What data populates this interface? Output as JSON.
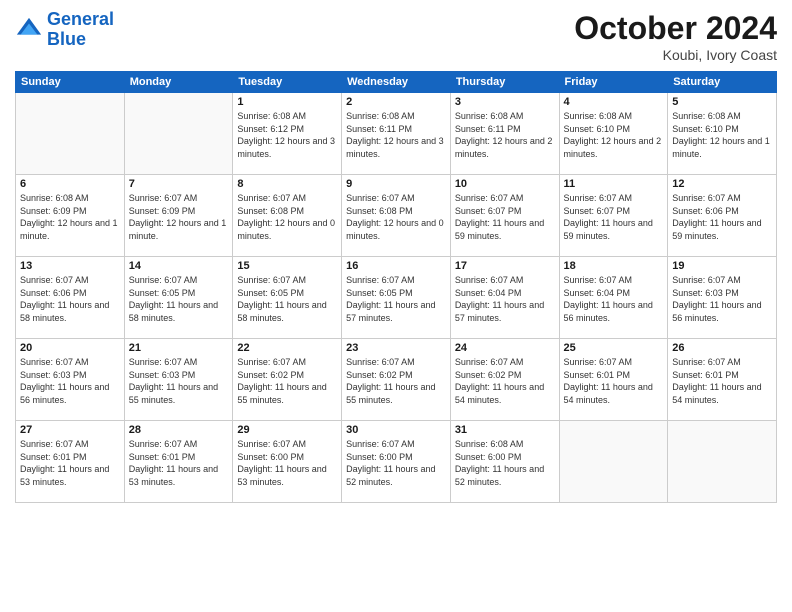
{
  "header": {
    "logo_general": "General",
    "logo_blue": "Blue",
    "month_title": "October 2024",
    "subtitle": "Koubi, Ivory Coast"
  },
  "days_of_week": [
    "Sunday",
    "Monday",
    "Tuesday",
    "Wednesday",
    "Thursday",
    "Friday",
    "Saturday"
  ],
  "weeks": [
    [
      {
        "day": "",
        "empty": true
      },
      {
        "day": "",
        "empty": true
      },
      {
        "day": "1",
        "sunrise": "Sunrise: 6:08 AM",
        "sunset": "Sunset: 6:12 PM",
        "daylight": "Daylight: 12 hours and 3 minutes."
      },
      {
        "day": "2",
        "sunrise": "Sunrise: 6:08 AM",
        "sunset": "Sunset: 6:11 PM",
        "daylight": "Daylight: 12 hours and 3 minutes."
      },
      {
        "day": "3",
        "sunrise": "Sunrise: 6:08 AM",
        "sunset": "Sunset: 6:11 PM",
        "daylight": "Daylight: 12 hours and 2 minutes."
      },
      {
        "day": "4",
        "sunrise": "Sunrise: 6:08 AM",
        "sunset": "Sunset: 6:10 PM",
        "daylight": "Daylight: 12 hours and 2 minutes."
      },
      {
        "day": "5",
        "sunrise": "Sunrise: 6:08 AM",
        "sunset": "Sunset: 6:10 PM",
        "daylight": "Daylight: 12 hours and 1 minute."
      }
    ],
    [
      {
        "day": "6",
        "sunrise": "Sunrise: 6:08 AM",
        "sunset": "Sunset: 6:09 PM",
        "daylight": "Daylight: 12 hours and 1 minute."
      },
      {
        "day": "7",
        "sunrise": "Sunrise: 6:07 AM",
        "sunset": "Sunset: 6:09 PM",
        "daylight": "Daylight: 12 hours and 1 minute."
      },
      {
        "day": "8",
        "sunrise": "Sunrise: 6:07 AM",
        "sunset": "Sunset: 6:08 PM",
        "daylight": "Daylight: 12 hours and 0 minutes."
      },
      {
        "day": "9",
        "sunrise": "Sunrise: 6:07 AM",
        "sunset": "Sunset: 6:08 PM",
        "daylight": "Daylight: 12 hours and 0 minutes."
      },
      {
        "day": "10",
        "sunrise": "Sunrise: 6:07 AM",
        "sunset": "Sunset: 6:07 PM",
        "daylight": "Daylight: 11 hours and 59 minutes."
      },
      {
        "day": "11",
        "sunrise": "Sunrise: 6:07 AM",
        "sunset": "Sunset: 6:07 PM",
        "daylight": "Daylight: 11 hours and 59 minutes."
      },
      {
        "day": "12",
        "sunrise": "Sunrise: 6:07 AM",
        "sunset": "Sunset: 6:06 PM",
        "daylight": "Daylight: 11 hours and 59 minutes."
      }
    ],
    [
      {
        "day": "13",
        "sunrise": "Sunrise: 6:07 AM",
        "sunset": "Sunset: 6:06 PM",
        "daylight": "Daylight: 11 hours and 58 minutes."
      },
      {
        "day": "14",
        "sunrise": "Sunrise: 6:07 AM",
        "sunset": "Sunset: 6:05 PM",
        "daylight": "Daylight: 11 hours and 58 minutes."
      },
      {
        "day": "15",
        "sunrise": "Sunrise: 6:07 AM",
        "sunset": "Sunset: 6:05 PM",
        "daylight": "Daylight: 11 hours and 58 minutes."
      },
      {
        "day": "16",
        "sunrise": "Sunrise: 6:07 AM",
        "sunset": "Sunset: 6:05 PM",
        "daylight": "Daylight: 11 hours and 57 minutes."
      },
      {
        "day": "17",
        "sunrise": "Sunrise: 6:07 AM",
        "sunset": "Sunset: 6:04 PM",
        "daylight": "Daylight: 11 hours and 57 minutes."
      },
      {
        "day": "18",
        "sunrise": "Sunrise: 6:07 AM",
        "sunset": "Sunset: 6:04 PM",
        "daylight": "Daylight: 11 hours and 56 minutes."
      },
      {
        "day": "19",
        "sunrise": "Sunrise: 6:07 AM",
        "sunset": "Sunset: 6:03 PM",
        "daylight": "Daylight: 11 hours and 56 minutes."
      }
    ],
    [
      {
        "day": "20",
        "sunrise": "Sunrise: 6:07 AM",
        "sunset": "Sunset: 6:03 PM",
        "daylight": "Daylight: 11 hours and 56 minutes."
      },
      {
        "day": "21",
        "sunrise": "Sunrise: 6:07 AM",
        "sunset": "Sunset: 6:03 PM",
        "daylight": "Daylight: 11 hours and 55 minutes."
      },
      {
        "day": "22",
        "sunrise": "Sunrise: 6:07 AM",
        "sunset": "Sunset: 6:02 PM",
        "daylight": "Daylight: 11 hours and 55 minutes."
      },
      {
        "day": "23",
        "sunrise": "Sunrise: 6:07 AM",
        "sunset": "Sunset: 6:02 PM",
        "daylight": "Daylight: 11 hours and 55 minutes."
      },
      {
        "day": "24",
        "sunrise": "Sunrise: 6:07 AM",
        "sunset": "Sunset: 6:02 PM",
        "daylight": "Daylight: 11 hours and 54 minutes."
      },
      {
        "day": "25",
        "sunrise": "Sunrise: 6:07 AM",
        "sunset": "Sunset: 6:01 PM",
        "daylight": "Daylight: 11 hours and 54 minutes."
      },
      {
        "day": "26",
        "sunrise": "Sunrise: 6:07 AM",
        "sunset": "Sunset: 6:01 PM",
        "daylight": "Daylight: 11 hours and 54 minutes."
      }
    ],
    [
      {
        "day": "27",
        "sunrise": "Sunrise: 6:07 AM",
        "sunset": "Sunset: 6:01 PM",
        "daylight": "Daylight: 11 hours and 53 minutes."
      },
      {
        "day": "28",
        "sunrise": "Sunrise: 6:07 AM",
        "sunset": "Sunset: 6:01 PM",
        "daylight": "Daylight: 11 hours and 53 minutes."
      },
      {
        "day": "29",
        "sunrise": "Sunrise: 6:07 AM",
        "sunset": "Sunset: 6:00 PM",
        "daylight": "Daylight: 11 hours and 53 minutes."
      },
      {
        "day": "30",
        "sunrise": "Sunrise: 6:07 AM",
        "sunset": "Sunset: 6:00 PM",
        "daylight": "Daylight: 11 hours and 52 minutes."
      },
      {
        "day": "31",
        "sunrise": "Sunrise: 6:08 AM",
        "sunset": "Sunset: 6:00 PM",
        "daylight": "Daylight: 11 hours and 52 minutes."
      },
      {
        "day": "",
        "empty": true
      },
      {
        "day": "",
        "empty": true
      }
    ]
  ]
}
